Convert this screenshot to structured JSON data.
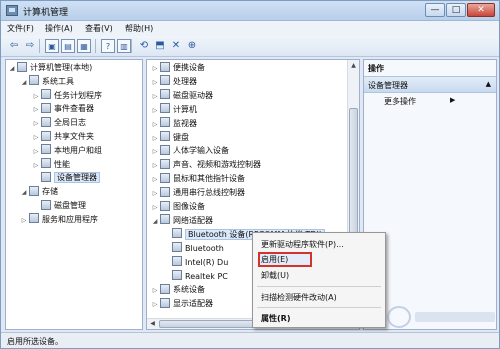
{
  "window": {
    "title": "计算机管理",
    "min": "—",
    "max": "□",
    "close": "✕"
  },
  "menu": [
    "文件(F)",
    "操作(A)",
    "查看(V)",
    "帮助(H)"
  ],
  "toolbar": [
    {
      "name": "back-icon",
      "glyph": "⇦"
    },
    {
      "name": "forward-icon",
      "glyph": "⇨"
    },
    {
      "name": "up-folder-icon",
      "glyph": "▣"
    },
    {
      "name": "show-tree-icon",
      "glyph": "▤"
    },
    {
      "name": "properties-icon",
      "glyph": "▦"
    },
    {
      "name": "help-icon",
      "glyph": "?"
    },
    {
      "name": "console-icon",
      "glyph": "▥"
    },
    {
      "name": "scan-icon",
      "glyph": "⟲"
    },
    {
      "name": "update-driver-icon",
      "glyph": "⬒"
    },
    {
      "name": "uninstall-icon",
      "glyph": "✕"
    },
    {
      "name": "enable-device-icon",
      "glyph": "⊕"
    }
  ],
  "left_tree": [
    {
      "label": "计算机管理(本地)",
      "indent": 0,
      "exp": "◢"
    },
    {
      "label": "系统工具",
      "indent": 1,
      "exp": "◢"
    },
    {
      "label": "任务计划程序",
      "indent": 2,
      "exp": "▷"
    },
    {
      "label": "事件查看器",
      "indent": 2,
      "exp": "▷"
    },
    {
      "label": "全局日志",
      "indent": 2,
      "exp": "▷"
    },
    {
      "label": "共享文件夹",
      "indent": 2,
      "exp": "▷"
    },
    {
      "label": "本地用户和组",
      "indent": 2,
      "exp": "▷"
    },
    {
      "label": "性能",
      "indent": 2,
      "exp": "▷"
    },
    {
      "label": "设备管理器",
      "indent": 2,
      "exp": "",
      "selected": true
    },
    {
      "label": "存储",
      "indent": 1,
      "exp": "◢"
    },
    {
      "label": "磁盘管理",
      "indent": 2,
      "exp": ""
    },
    {
      "label": "服务和应用程序",
      "indent": 1,
      "exp": "▷"
    }
  ],
  "device_tree": [
    {
      "label": "便携设备",
      "indent": 0,
      "exp": "▷"
    },
    {
      "label": "处理器",
      "indent": 0,
      "exp": "▷"
    },
    {
      "label": "磁盘驱动器",
      "indent": 0,
      "exp": "▷"
    },
    {
      "label": "计算机",
      "indent": 0,
      "exp": "▷"
    },
    {
      "label": "监视器",
      "indent": 0,
      "exp": "▷"
    },
    {
      "label": "键盘",
      "indent": 0,
      "exp": "▷"
    },
    {
      "label": "人体学输入设备",
      "indent": 0,
      "exp": "▷"
    },
    {
      "label": "声音、视频和游戏控制器",
      "indent": 0,
      "exp": "▷"
    },
    {
      "label": "鼠标和其他指针设备",
      "indent": 0,
      "exp": "▷"
    },
    {
      "label": "通用串行总线控制器",
      "indent": 0,
      "exp": "▷"
    },
    {
      "label": "图像设备",
      "indent": 0,
      "exp": "▷"
    },
    {
      "label": "网络适配器",
      "indent": 0,
      "exp": "◢"
    },
    {
      "label": "Bluetooth 设备(RFCOMM 协议 TDI)",
      "indent": 1,
      "exp": "",
      "selected": true
    },
    {
      "label": "Bluetooth",
      "indent": 1,
      "exp": ""
    },
    {
      "label": "Intel(R) Du",
      "indent": 1,
      "exp": ""
    },
    {
      "label": "Realtek PC",
      "indent": 1,
      "exp": ""
    },
    {
      "label": "系统设备",
      "indent": 0,
      "exp": "▷"
    },
    {
      "label": "显示适配器",
      "indent": 0,
      "exp": "▷"
    }
  ],
  "actions": {
    "header": "操作",
    "section": "设备管理器",
    "more": "更多操作",
    "section_caret": "▲",
    "more_caret": "▶"
  },
  "context_menu": [
    "更新驱动程序软件(P)...",
    "启用(E)",
    "卸载(U)",
    "扫描检测硬件改动(A)",
    "属性(R)"
  ],
  "status": "启用所选设备。",
  "colors": {
    "highlight_border": "#d2342b",
    "accent": "#2c5aa0"
  }
}
